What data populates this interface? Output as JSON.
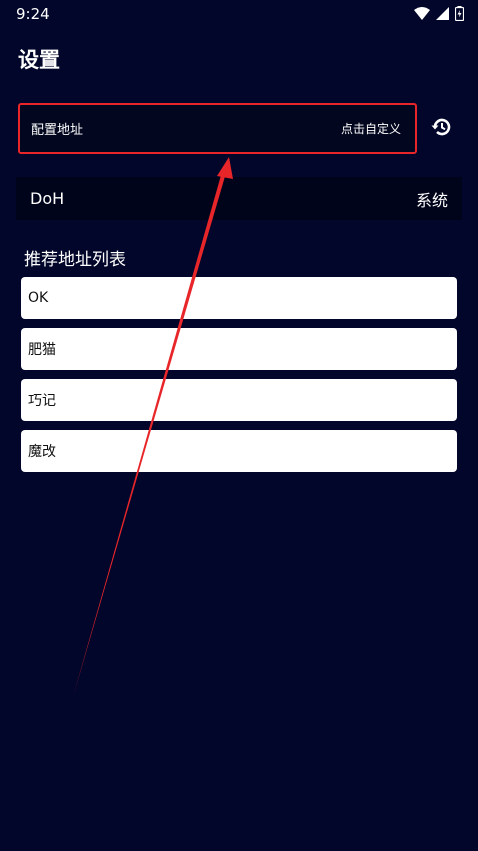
{
  "status_bar": {
    "time": "9:24",
    "icons": [
      "wifi-icon",
      "cellular-signal-icon",
      "battery-charging-icon"
    ]
  },
  "page": {
    "title": "设置"
  },
  "config": {
    "label": "配置地址",
    "action": "点击自定义",
    "history_icon": "history-icon"
  },
  "doh": {
    "label": "DoH",
    "value": "系统"
  },
  "recommended": {
    "title": "推荐地址列表",
    "items": [
      "OK",
      "肥猫",
      "巧记",
      "魔改"
    ]
  },
  "colors": {
    "background": "#01062a",
    "highlight_box": "#e8262a",
    "annotation_arrow": "#e8262a",
    "card": "#ffffff"
  }
}
